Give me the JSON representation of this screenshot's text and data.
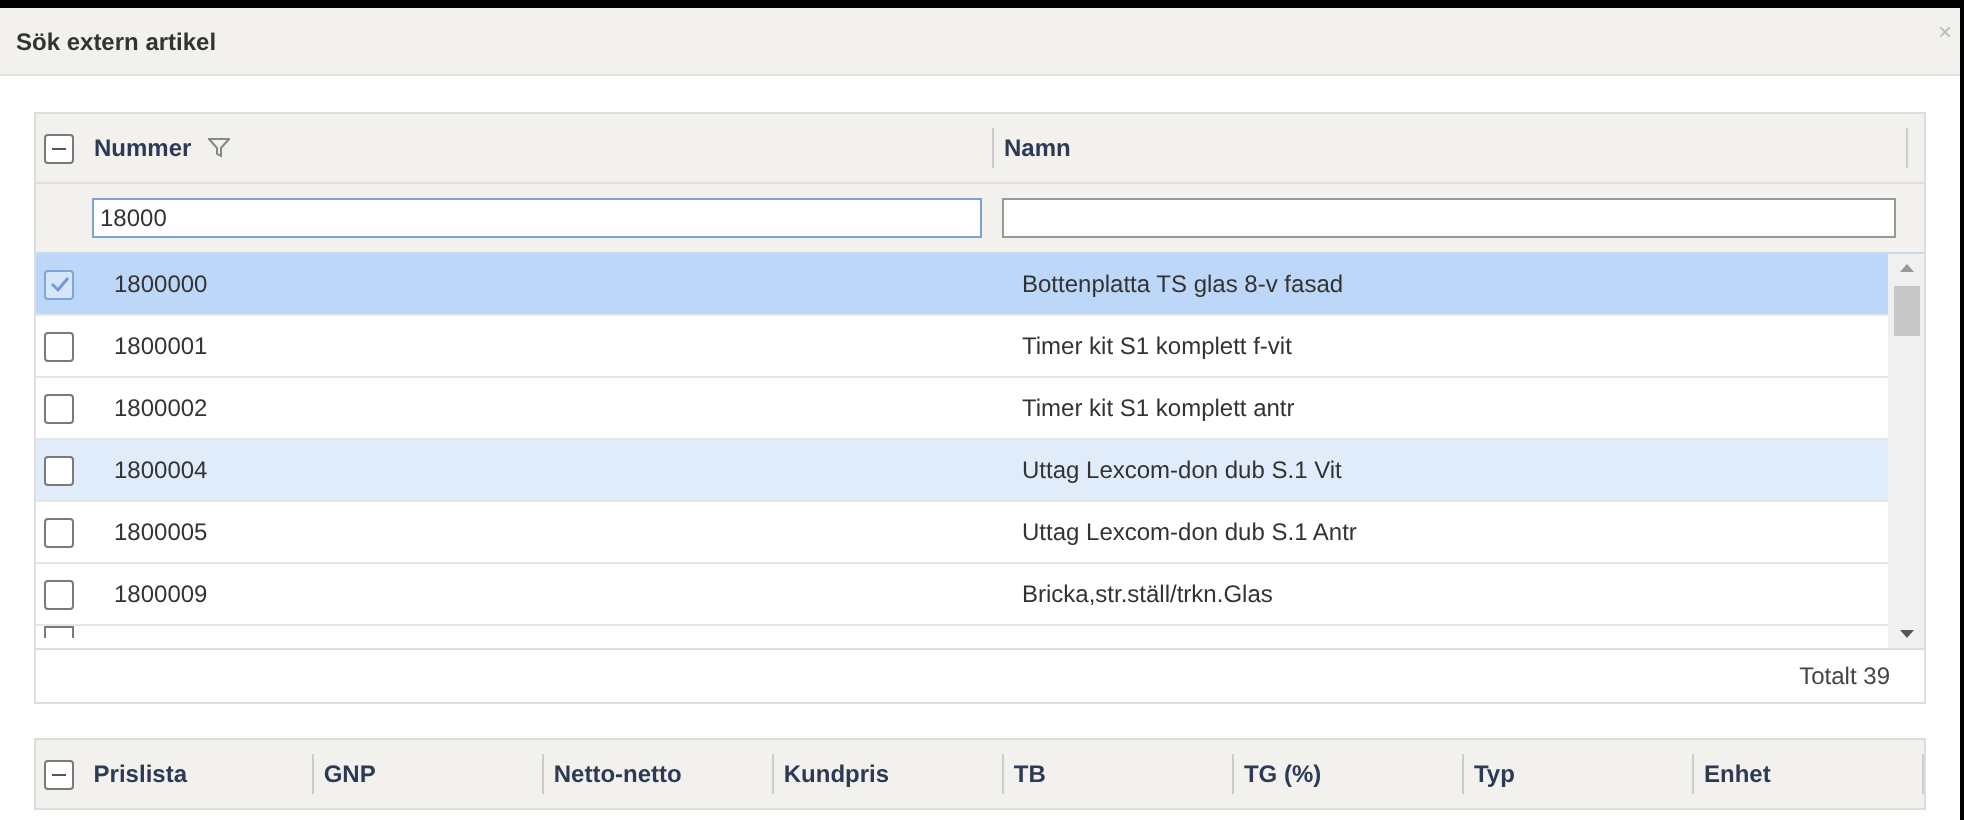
{
  "dialog": {
    "title": "Sök extern artikel",
    "close": "×"
  },
  "grid": {
    "columns": [
      {
        "label": "Nummer",
        "filter_icon": true,
        "filter_value": "18000"
      },
      {
        "label": "Namn",
        "filter_icon": false
      }
    ],
    "rows": [
      {
        "number": "1800000",
        "name": "Bottenplatta TS glas 8-v fasad",
        "selected": true,
        "hovered": false
      },
      {
        "number": "1800001",
        "name": "Timer kit S1 komplett f-vit",
        "selected": false,
        "hovered": false
      },
      {
        "number": "1800002",
        "name": "Timer kit S1 komplett antr",
        "selected": false,
        "hovered": false
      },
      {
        "number": "1800004",
        "name": "Uttag Lexcom-don dub S.1 Vit",
        "selected": false,
        "hovered": true
      },
      {
        "number": "1800005",
        "name": "Uttag Lexcom-don dub S.1 Antr",
        "selected": false,
        "hovered": false
      },
      {
        "number": "1800009",
        "name": "Bricka,str.ställ/trkn.Glas",
        "selected": false,
        "hovered": false
      }
    ],
    "total": "Totalt 39"
  },
  "price_grid": {
    "columns": [
      "Prislista",
      "GNP",
      "Netto-netto",
      "Kundpris",
      "TB",
      "TG (%)",
      "Typ",
      "Enhet"
    ]
  }
}
